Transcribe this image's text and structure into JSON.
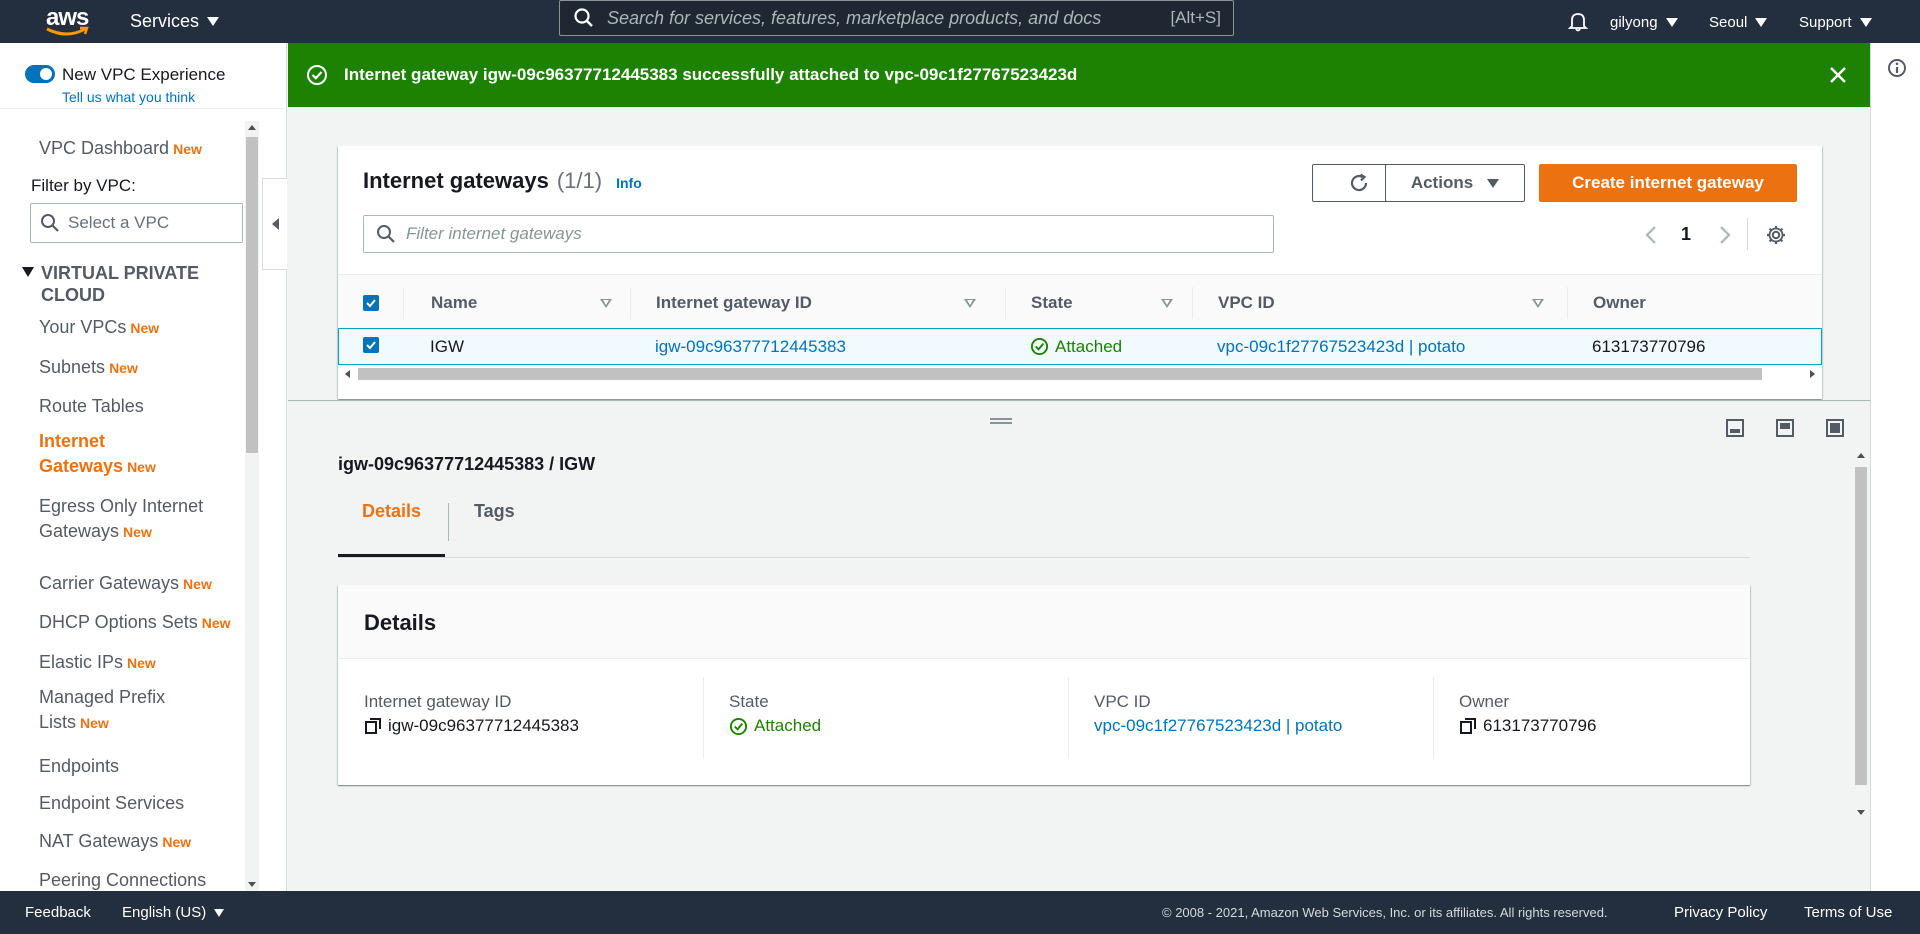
{
  "topnav": {
    "logo": "aws",
    "services": "Services",
    "search_placeholder": "Search for services, features, marketplace products, and docs",
    "search_shortcut": "[Alt+S]",
    "user": "gilyong",
    "region": "Seoul",
    "support": "Support"
  },
  "sidebar": {
    "experience_label": "New VPC Experience",
    "feedback_link": "Tell us what you think",
    "dashboard": "VPC Dashboard",
    "new_badge": "New",
    "filter_label": "Filter by VPC:",
    "filter_placeholder": "Select a VPC",
    "section_title_1": "VIRTUAL PRIVATE",
    "section_title_2": "CLOUD",
    "items": [
      {
        "label": "Your VPCs",
        "new": "New"
      },
      {
        "label": "Subnets",
        "new": "New"
      },
      {
        "label": "Route Tables",
        "new": ""
      },
      {
        "label_1": "Internet",
        "label_2": "Gateways",
        "new": "New"
      },
      {
        "label_1": "Egress Only Internet",
        "label_2": "Gateways",
        "new": "New"
      },
      {
        "label": "Carrier Gateways",
        "new": "New"
      },
      {
        "label": "DHCP Options Sets",
        "new": "New"
      },
      {
        "label": "Elastic IPs",
        "new": "New"
      },
      {
        "label_1": "Managed Prefix",
        "label_2": "Lists",
        "new": "New"
      },
      {
        "label": "Endpoints",
        "new": ""
      },
      {
        "label": "Endpoint Services",
        "new": ""
      },
      {
        "label": "NAT Gateways",
        "new": "New"
      },
      {
        "label": "Peering Connections",
        "new": ""
      }
    ]
  },
  "flash": {
    "message": "Internet gateway igw-09c96377712445383 successfully attached to vpc-09c1f27767523423d"
  },
  "table": {
    "title": "Internet gateways",
    "count": "(1/1)",
    "info": "Info",
    "actions": "Actions",
    "create": "Create internet gateway",
    "filter_placeholder": "Filter internet gateways",
    "page": "1",
    "columns": [
      "Name",
      "Internet gateway ID",
      "State",
      "VPC ID",
      "Owner"
    ],
    "rows": [
      {
        "name": "IGW",
        "id": "igw-09c96377712445383",
        "state": "Attached",
        "vpc": "vpc-09c1f27767523423d | potato",
        "owner": "613173770796"
      }
    ]
  },
  "split": {
    "title": "igw-09c96377712445383 / IGW",
    "tabs": [
      "Details",
      "Tags"
    ],
    "details_title": "Details",
    "fields": [
      {
        "label": "Internet gateway ID",
        "value": "igw-09c96377712445383"
      },
      {
        "label": "State",
        "value": "Attached"
      },
      {
        "label": "VPC ID",
        "value": "vpc-09c1f27767523423d | potato"
      },
      {
        "label": "Owner",
        "value": "613173770796"
      }
    ]
  },
  "footer": {
    "feedback": "Feedback",
    "language": "English (US)",
    "copyright": "© 2008 - 2021, Amazon Web Services, Inc. or its affiliates. All rights reserved.",
    "privacy": "Privacy Policy",
    "terms": "Terms of Use"
  },
  "colors": {
    "nav_bg": "#232f3e",
    "accent": "#ec7211",
    "link": "#0073bb",
    "success": "#1d8102"
  }
}
